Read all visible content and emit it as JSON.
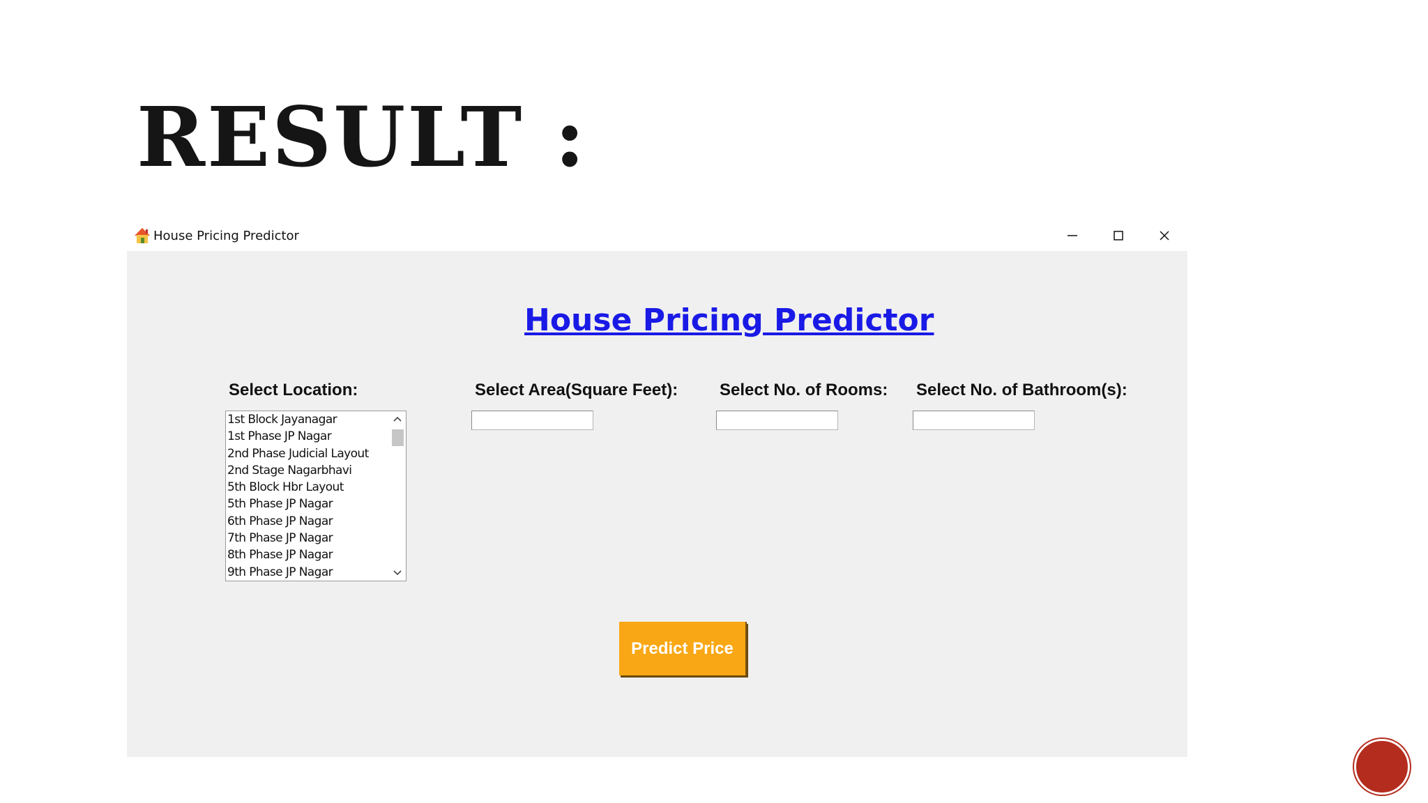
{
  "slide": {
    "title": "RESULT :"
  },
  "window": {
    "title": "House Pricing Predictor",
    "app_icon": "house-icon",
    "controls": {
      "minimize": "minimize-icon",
      "maximize": "maximize-icon",
      "close": "close-icon"
    }
  },
  "app": {
    "heading": "House Pricing Predictor",
    "heading_color": "#1a1ae6",
    "labels": {
      "location": "Select Location:",
      "area": "Select Area(Square Feet):",
      "rooms": "Select No. of Rooms:",
      "bathrooms": "Select No. of Bathroom(s):"
    },
    "locations": [
      "1st Block Jayanagar",
      "1st Phase JP Nagar",
      "2nd Phase Judicial Layout",
      "2nd Stage Nagarbhavi",
      "5th Block Hbr Layout",
      "5th Phase JP Nagar",
      "6th Phase JP Nagar",
      "7th Phase JP Nagar",
      "8th Phase JP Nagar",
      "9th Phase JP Nagar"
    ],
    "inputs": {
      "area": "",
      "rooms": "",
      "bathrooms": ""
    },
    "predict_button": "Predict Price",
    "predict_button_color": "#f9a714",
    "background_color": "#f0f0f0"
  }
}
